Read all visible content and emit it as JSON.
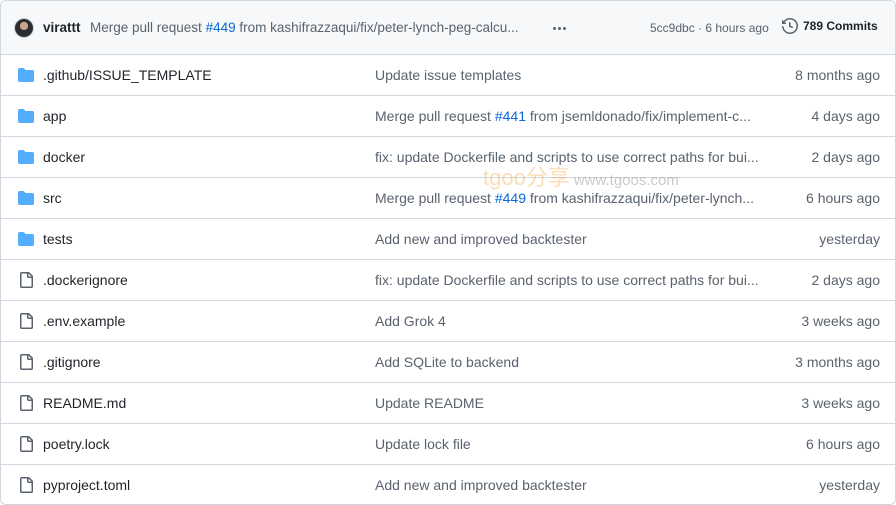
{
  "header": {
    "author": "virattt",
    "message_prefix": "Merge pull request ",
    "pr_link": "#449",
    "message_suffix": " from kashifrazzaqui/fix/peter-lynch-peg-calcu...",
    "sha": "5cc9dbc",
    "separator": " · ",
    "time": "6 hours ago",
    "commits_label": "789 Commits"
  },
  "rows": [
    {
      "type": "folder",
      "name": ".github/ISSUE_TEMPLATE",
      "message": "Update issue templates",
      "age": "8 months ago"
    },
    {
      "type": "folder",
      "name": "app",
      "message_prefix": "Merge pull request ",
      "pr_link": "#441",
      "message_suffix": " from jsemldonado/fix/implement-c...",
      "age": "4 days ago"
    },
    {
      "type": "folder",
      "name": "docker",
      "message": "fix: update Dockerfile and scripts to use correct paths for bui...",
      "age": "2 days ago"
    },
    {
      "type": "folder",
      "name": "src",
      "message_prefix": "Merge pull request ",
      "pr_link": "#449",
      "message_suffix": " from kashifrazzaqui/fix/peter-lynch...",
      "age": "6 hours ago"
    },
    {
      "type": "folder",
      "name": "tests",
      "message": "Add new and improved backtester",
      "age": "yesterday"
    },
    {
      "type": "file",
      "name": ".dockerignore",
      "message": "fix: update Dockerfile and scripts to use correct paths for bui...",
      "age": "2 days ago"
    },
    {
      "type": "file",
      "name": ".env.example",
      "message": "Add Grok 4",
      "age": "3 weeks ago"
    },
    {
      "type": "file",
      "name": ".gitignore",
      "message": "Add SQLite to backend",
      "age": "3 months ago"
    },
    {
      "type": "file",
      "name": "README.md",
      "message": "Update README",
      "age": "3 weeks ago"
    },
    {
      "type": "file",
      "name": "poetry.lock",
      "message": "Update lock file",
      "age": "6 hours ago"
    },
    {
      "type": "file",
      "name": "pyproject.toml",
      "message": "Add new and improved backtester",
      "age": "yesterday"
    }
  ],
  "watermark": {
    "brand": "tgoo分享",
    "url": "www.tgoos.com"
  },
  "colors": {
    "folder": "#54aeff",
    "link": "#0969da",
    "muted": "#59636e",
    "border": "#d0d7de"
  },
  "icons": {
    "folder": "folder-icon",
    "file": "file-icon",
    "history": "history-icon",
    "ellipsis": "ellipsis-icon"
  }
}
